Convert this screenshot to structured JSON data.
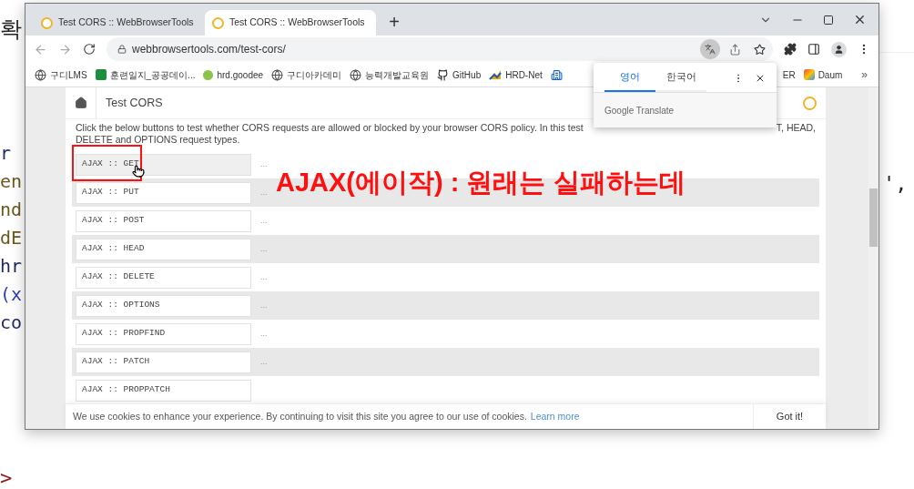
{
  "background_editor": {
    "heading": "확",
    "lines": [
      {
        "text": "r",
        "color": "#1f2a7a"
      },
      {
        "text": "en",
        "color": "#6b5a1e"
      },
      {
        "text": "nd",
        "color": "#6b5a1e"
      },
      {
        "text": "dE",
        "color": "#6b5a1e"
      },
      {
        "text": "hr",
        "color": "#1f2a5a"
      },
      {
        "text": "(x",
        "color": "#2b3fb0"
      },
      {
        "text": "co",
        "color": "#1f2a5a"
      }
    ],
    "right_fragment": "',",
    "bottom_fragment": ">"
  },
  "browser": {
    "tabs": [
      {
        "title": "Test CORS :: WebBrowserTools",
        "selected": false
      },
      {
        "title": "Test CORS :: WebBrowserTools",
        "selected": true
      }
    ],
    "new_tab": "+",
    "address": "webbrowsertools.com/test-cors/",
    "translate_active": true,
    "bookmarks": [
      {
        "label": "구디LMS"
      },
      {
        "label": "훈련일지_공공데이..."
      },
      {
        "label": "hrd.goodee"
      },
      {
        "label": "구디아카데미"
      },
      {
        "label": "능력개발교육원"
      },
      {
        "label": "GitHub"
      },
      {
        "label": "HRD-Net"
      },
      {
        "label": "ER"
      },
      {
        "label": "Daum"
      }
    ],
    "more_bookmarks": "»",
    "translate_popup": {
      "tabs": [
        {
          "label": "영어",
          "selected": true
        },
        {
          "label": "한국어",
          "selected": false
        }
      ],
      "footer": "Google Translate"
    },
    "page": {
      "title": "Test CORS",
      "description": {
        "line1_left": "Click the below buttons to test whether CORS requests are allowed or blocked by your browser CORS policy. In this test",
        "line1_right": "T, HEAD,",
        "line2": "DELETE and OPTIONS request types."
      },
      "rows": [
        {
          "button": "AJAX :: GET",
          "result": "...",
          "hovered": true
        },
        {
          "button": "AJAX :: PUT",
          "result": "...",
          "hovered": false
        },
        {
          "button": "AJAX :: POST",
          "result": "...",
          "hovered": false
        },
        {
          "button": "AJAX :: HEAD",
          "result": "...",
          "hovered": false
        },
        {
          "button": "AJAX :: DELETE",
          "result": "...",
          "hovered": false
        },
        {
          "button": "AJAX :: OPTIONS",
          "result": "...",
          "hovered": false
        },
        {
          "button": "AJAX :: PROPFIND",
          "result": "...",
          "hovered": false
        },
        {
          "button": "AJAX :: PATCH",
          "result": "...",
          "hovered": false
        },
        {
          "button": "AJAX :: PROPPATCH",
          "hovered": false
        }
      ],
      "cookie_bar": {
        "text": "We use cookies to enhance your experience. By continuing to visit this site you agree to our use of cookies.",
        "link": "Learn more",
        "button": "Got it!"
      }
    }
  },
  "annotation": {
    "caption": "AJAX(에이작) : 원래는 실패하는데"
  }
}
